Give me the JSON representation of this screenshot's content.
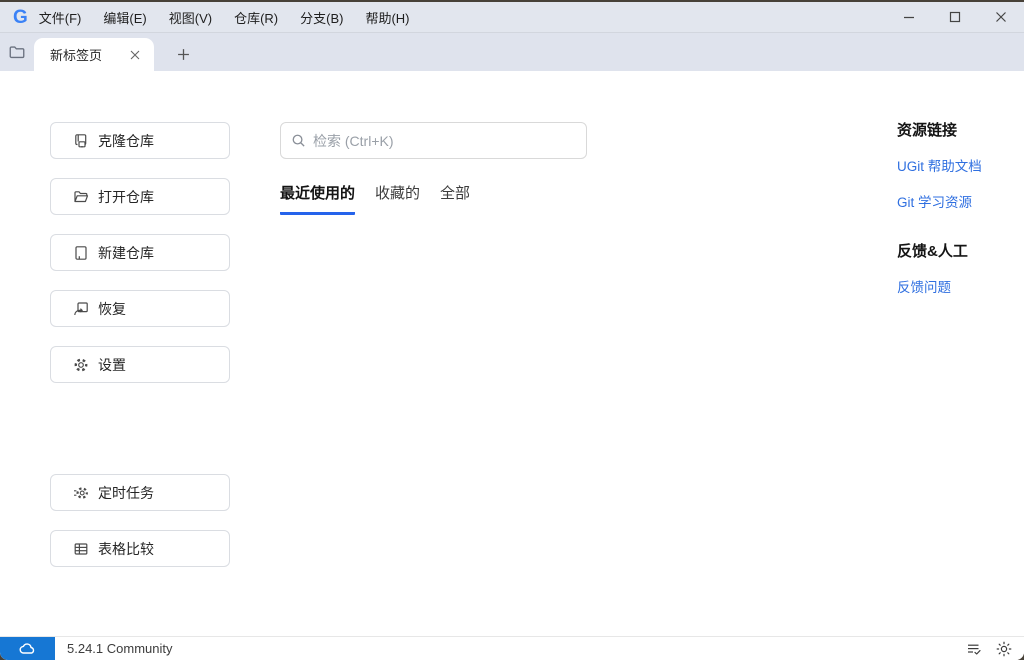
{
  "window": {
    "logo_text": "G",
    "menu": [
      "文件(F)",
      "编辑(E)",
      "视图(V)",
      "仓库(R)",
      "分支(B)",
      "帮助(H)"
    ],
    "controls": [
      "minimize",
      "maximize",
      "close"
    ]
  },
  "tabbar": {
    "active_tab_label": "新标签页"
  },
  "sidebar": {
    "buttons": [
      {
        "label": "克隆仓库",
        "icon": "clone-repo-icon"
      },
      {
        "label": "打开仓库",
        "icon": "open-folder-icon"
      },
      {
        "label": "新建仓库",
        "icon": "new-repo-icon"
      },
      {
        "label": "恢复",
        "icon": "restore-icon"
      },
      {
        "label": "设置",
        "icon": "settings-gear-icon"
      }
    ],
    "tools": [
      {
        "label": "定时任务",
        "icon": "scheduled-task-icon"
      },
      {
        "label": "表格比较",
        "icon": "table-compare-icon"
      }
    ]
  },
  "main": {
    "search": {
      "placeholder": "检索 (Ctrl+K)"
    },
    "filter_tabs": [
      {
        "label": "最近使用的",
        "active": true
      },
      {
        "label": "收藏的",
        "active": false
      },
      {
        "label": "全部",
        "active": false
      }
    ]
  },
  "aside": {
    "sections": [
      {
        "title": "资源链接",
        "links": [
          "UGit 帮助文档",
          "Git 学习资源"
        ]
      },
      {
        "title": "反馈&人工",
        "links": [
          "反馈问题"
        ]
      }
    ]
  },
  "statusbar": {
    "version": "5.24.1 Community",
    "icons": [
      "cloud-icon",
      "log-check-icon",
      "theme-sun-icon"
    ]
  },
  "colors": {
    "titlebar_bg": "#e2e6ee",
    "tabbar_bg": "#dfe3ed",
    "accent_underline": "#2563eb",
    "link_blue": "#2f6fe0",
    "version_badge_blue": "#1677d4",
    "logo_blue": "#3b82f6"
  }
}
